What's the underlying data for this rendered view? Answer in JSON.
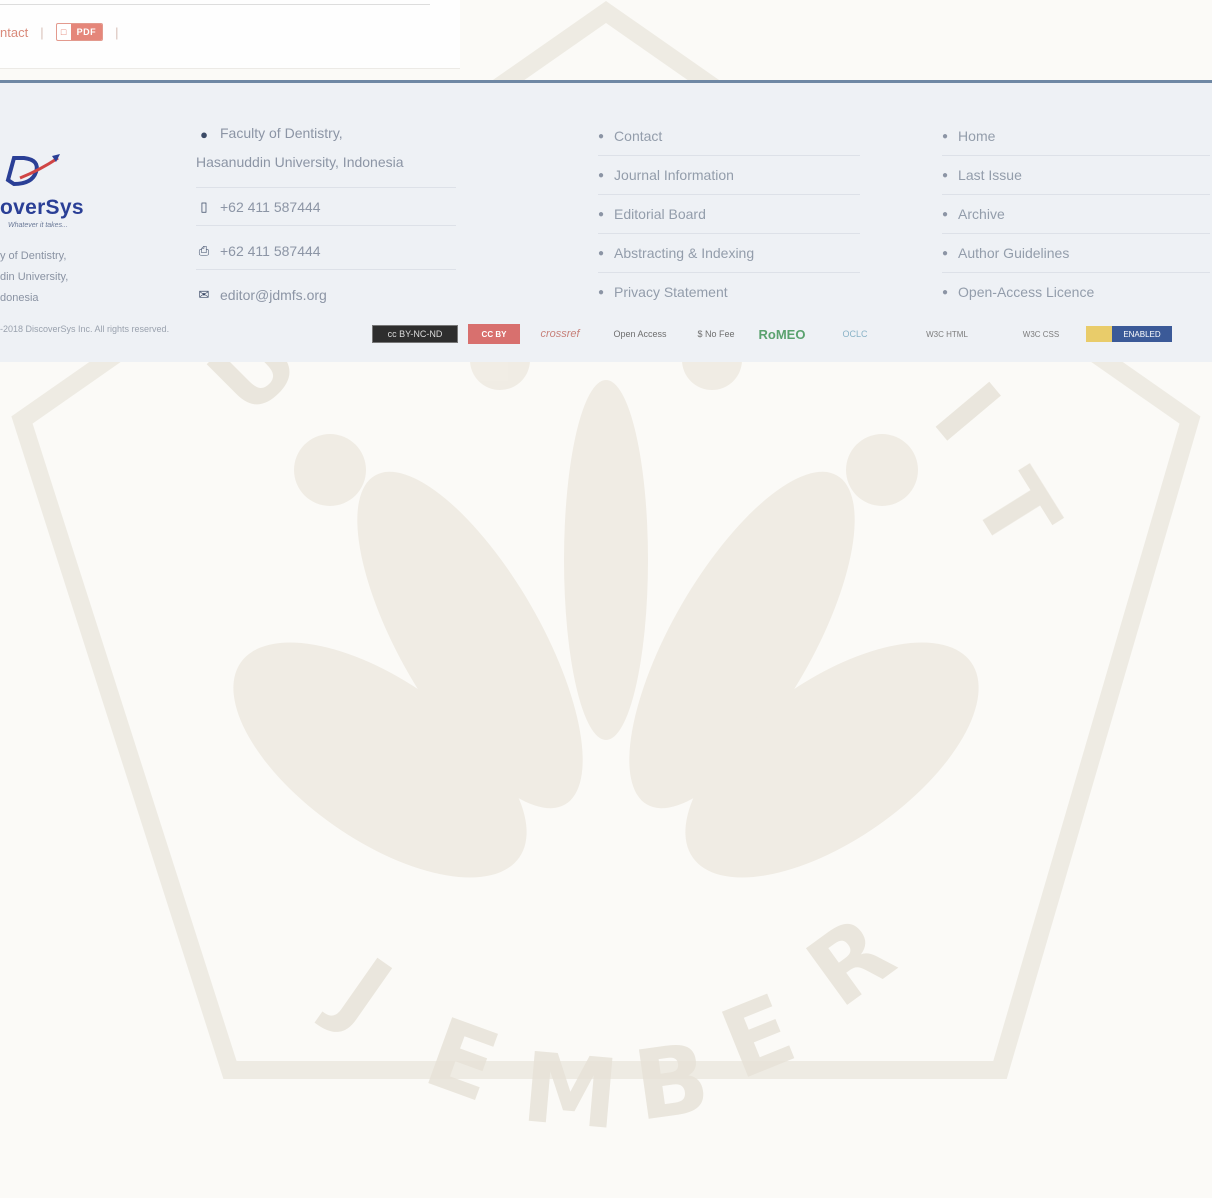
{
  "top": {
    "contact": "ntact",
    "separator": "|",
    "pdf_label": "PDF"
  },
  "brand": {
    "name": "overSys",
    "tagline": "Whatever it takes...",
    "address": [
      "y of Dentistry,",
      "din University,",
      "donesia"
    ]
  },
  "contact": {
    "address_line1": "Faculty of Dentistry,",
    "address_line2": "Hasanuddin University, Indonesia",
    "phone": "+62 411 587444",
    "fax": "+62 411 587444",
    "email": "editor@jdmfs.org"
  },
  "links_left": [
    {
      "label": "Contact"
    },
    {
      "label": "Journal Information"
    },
    {
      "label": "Editorial Board"
    },
    {
      "label": "Abstracting & Indexing"
    },
    {
      "label": "Privacy Statement"
    }
  ],
  "links_right": [
    {
      "label": "Home"
    },
    {
      "label": "Last Issue"
    },
    {
      "label": "Archive"
    },
    {
      "label": "Author Guidelines"
    },
    {
      "label": "Open-Access Licence"
    }
  ],
  "copyright": "-2018 DiscoverSys Inc. All rights reserved.",
  "badges": {
    "cc": "cc BY-NC-ND",
    "ccby": "CC BY",
    "crossref": "crossref",
    "open_access": "Open Access",
    "no_fee": "$ No Fee",
    "romeo": "RoMEO",
    "oclc": "OCLC",
    "w3c_html": "W3C HTML",
    "w3c_css": "W3C CSS",
    "enabled": "ENABLED"
  },
  "colors": {
    "footer_bg": "#eef1f5",
    "footer_border": "#6f88a4",
    "brand": "#2a3f96",
    "link_text": "#939dab"
  }
}
